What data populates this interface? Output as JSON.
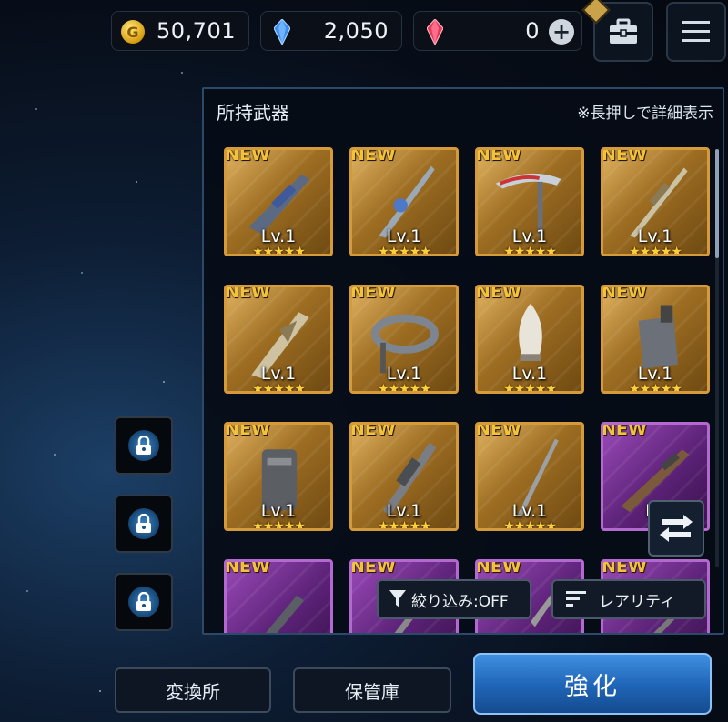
{
  "currency": {
    "gold_icon": "G",
    "gold": "50,701",
    "crystal": "2,050",
    "premium": "0"
  },
  "header_buttons": [
    "briefcase-icon",
    "hamburger-menu-icon"
  ],
  "panel": {
    "title": "所持武器",
    "hint": "※長押しで詳細表示"
  },
  "weapons": [
    {
      "new": "NEW",
      "level": "Lv.1",
      "stars": "★★★★★",
      "rarity": "gold"
    },
    {
      "new": "NEW",
      "level": "Lv.1",
      "stars": "★★★★★",
      "rarity": "gold"
    },
    {
      "new": "NEW",
      "level": "Lv.1",
      "stars": "★★★★★",
      "rarity": "gold"
    },
    {
      "new": "NEW",
      "level": "Lv.1",
      "stars": "★★★★★",
      "rarity": "gold"
    },
    {
      "new": "NEW",
      "level": "Lv.1",
      "stars": "★★★★★",
      "rarity": "gold"
    },
    {
      "new": "NEW",
      "level": "Lv.1",
      "stars": "★★★★★",
      "rarity": "gold"
    },
    {
      "new": "NEW",
      "level": "Lv.1",
      "stars": "★★★★★",
      "rarity": "gold"
    },
    {
      "new": "NEW",
      "level": "Lv.1",
      "stars": "★★★★★",
      "rarity": "gold"
    },
    {
      "new": "NEW",
      "level": "Lv.1",
      "stars": "★★★★★",
      "rarity": "gold"
    },
    {
      "new": "NEW",
      "level": "Lv.1",
      "stars": "★★★★★",
      "rarity": "gold"
    },
    {
      "new": "NEW",
      "level": "Lv.1",
      "stars": "★★★★★",
      "rarity": "gold"
    },
    {
      "new": "NEW",
      "level": "Lv",
      "stars": "★",
      "rarity": "purple"
    },
    {
      "new": "NEW",
      "level": "",
      "stars": "",
      "rarity": "purple"
    },
    {
      "new": "NEW",
      "level": "",
      "stars": "",
      "rarity": "purple"
    },
    {
      "new": "NEW",
      "level": "",
      "stars": "",
      "rarity": "purple"
    },
    {
      "new": "NEW",
      "level": "",
      "stars": "",
      "rarity": "purple"
    }
  ],
  "filter": {
    "label": "絞り込み:OFF"
  },
  "sort": {
    "label": "レアリティ"
  },
  "bottom": {
    "exchange": "変換所",
    "storage": "保管庫",
    "enhance": "強化"
  },
  "colors": {
    "gold_frame": "#d59a3a",
    "purple_frame": "#b369cf",
    "enhance_button": "#1f64b6"
  }
}
